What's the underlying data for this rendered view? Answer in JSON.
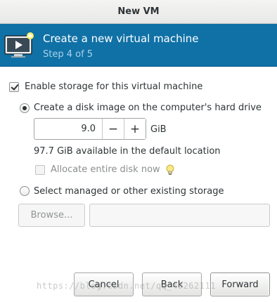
{
  "window": {
    "title": "New VM"
  },
  "header": {
    "title": "Create a new virtual machine",
    "step": "Step 4 of 5",
    "icon": "monitor-play-icon",
    "bg_color": "#1071a6"
  },
  "storage": {
    "enable_label": "Enable storage for this virtual machine",
    "enable_checked": true,
    "create_disk_label": "Create a disk image on the computer's hard drive",
    "create_disk_selected": true,
    "size_value": "9.0",
    "size_unit": "GiB",
    "decrement_symbol": "−",
    "increment_symbol": "+",
    "available_text": "97.7 GiB available in the default location",
    "allocate_label": "Allocate entire disk now",
    "allocate_checked": false,
    "allocate_hint_icon": "lightbulb-icon",
    "managed_label": "Select managed or other existing storage",
    "managed_selected": false,
    "browse_label": "Browse...",
    "path_value": ""
  },
  "buttons": {
    "cancel": "Cancel",
    "back": "Back",
    "forward": "Forward"
  },
  "watermark": "https://blog.csdn.net/qq_40262111"
}
